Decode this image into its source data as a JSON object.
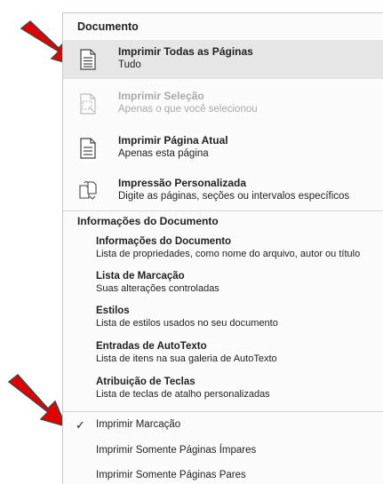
{
  "menu": {
    "section_title": "Documento",
    "options": [
      {
        "title": "Imprimir Todas as Páginas",
        "subtitle": "Tudo",
        "icon": "full-page-icon",
        "selected": true,
        "disabled": false
      },
      {
        "title": "Imprimir Seleção",
        "subtitle": "Apenas o que você selecionou",
        "icon": "selection-page-icon",
        "selected": false,
        "disabled": true
      },
      {
        "title": "Imprimir Página Atual",
        "subtitle": "Apenas esta página",
        "icon": "current-page-icon",
        "selected": false,
        "disabled": false
      },
      {
        "title": "Impressão Personalizada",
        "subtitle": "Digite as páginas, seções ou intervalos específicos",
        "icon": "custom-pages-icon",
        "selected": false,
        "disabled": false
      }
    ],
    "info_section_title": "Informações do Documento",
    "info_items": [
      {
        "title": "Informações do Documento",
        "subtitle": "Lista de propriedades, como nome do arquivo, autor ou título"
      },
      {
        "title": "Lista de Marcação",
        "subtitle": "Suas alterações controladas"
      },
      {
        "title": "Estilos",
        "subtitle": "Lista de estilos usados no seu documento"
      },
      {
        "title": "Entradas de AutoTexto",
        "subtitle": "Lista de itens na sua galeria de AutoTexto"
      },
      {
        "title": "Atribuição de Teclas",
        "subtitle": "Lista de teclas de atalho personalizadas"
      }
    ],
    "toggles": [
      {
        "label": "Imprimir Marcação",
        "checked": true,
        "check_glyph": "✓"
      },
      {
        "label": "Imprimir Somente Páginas Ímpares",
        "checked": false
      },
      {
        "label": "Imprimir Somente Páginas Pares",
        "checked": false
      }
    ]
  },
  "colors": {
    "arrow": "#e00000",
    "selected_bg": "#e6e6e6",
    "disabled_text": "#a9a9a9"
  }
}
